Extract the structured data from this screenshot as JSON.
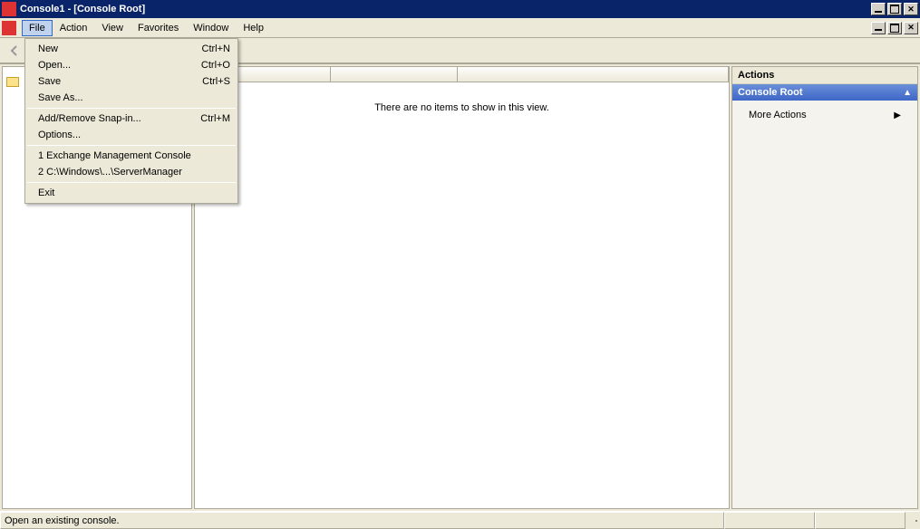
{
  "window": {
    "title": "Console1 - [Console Root]"
  },
  "menubar": {
    "items": [
      "File",
      "Action",
      "View",
      "Favorites",
      "Window",
      "Help"
    ]
  },
  "file_menu": {
    "group1": [
      {
        "label": "New",
        "shortcut": "Ctrl+N"
      },
      {
        "label": "Open...",
        "shortcut": "Ctrl+O"
      },
      {
        "label": "Save",
        "shortcut": "Ctrl+S"
      },
      {
        "label": "Save As...",
        "shortcut": ""
      }
    ],
    "group2": [
      {
        "label": "Add/Remove Snap-in...",
        "shortcut": "Ctrl+M"
      },
      {
        "label": "Options...",
        "shortcut": ""
      }
    ],
    "group3": [
      {
        "label": "1 Exchange Management Console",
        "shortcut": ""
      },
      {
        "label": "2 C:\\Windows\\...\\ServerManager",
        "shortcut": ""
      }
    ],
    "group4": [
      {
        "label": "Exit",
        "shortcut": ""
      }
    ]
  },
  "tree": {
    "root_label": ""
  },
  "center": {
    "empty_text": "There are no items to show in this view."
  },
  "actions": {
    "header": "Actions",
    "section": "Console Root",
    "more": "More Actions"
  },
  "statusbar": {
    "text": "Open an existing console."
  }
}
